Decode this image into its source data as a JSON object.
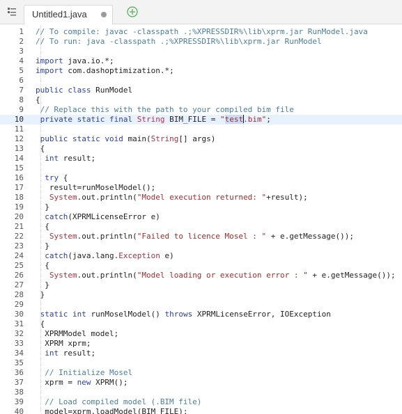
{
  "tab": {
    "title": "Untitled1.java"
  },
  "icons": {
    "menu": "list-menu-icon",
    "unsaved": "unsaved-dot-icon",
    "add": "plus-circle-icon"
  },
  "colors": {
    "comment": "#4a7fa0",
    "keyword": "#2a3fb0",
    "type": "#b03040",
    "string": "#a62a2a",
    "active_line": "#e8f2ff"
  },
  "editor": {
    "active_line": 10,
    "lines": [
      [
        [
          "c",
          "// To compile: javac -classpath .;%XPRESSDIR%\\lib\\xprm.jar RunModel.java"
        ]
      ],
      [
        [
          "c",
          "// To run: java -classpath .;%XPRESSDIR%\\lib\\xprm.jar RunModel"
        ]
      ],
      [],
      [
        [
          "k",
          "import"
        ],
        [
          "n",
          " java.io.*;"
        ]
      ],
      [
        [
          "k",
          "import"
        ],
        [
          "n",
          " com.dashoptimization.*;"
        ]
      ],
      [],
      [
        [
          "k",
          "public"
        ],
        [
          "n",
          " "
        ],
        [
          "k",
          "class"
        ],
        [
          "n",
          " RunModel"
        ]
      ],
      [
        [
          "n",
          "{"
        ]
      ],
      [
        [
          "n",
          " "
        ],
        [
          "c",
          "// Replace this with the path to your compiled bim file"
        ]
      ],
      [
        [
          "n",
          " "
        ],
        [
          "k",
          "private"
        ],
        [
          "n",
          " "
        ],
        [
          "k",
          "static"
        ],
        [
          "n",
          " "
        ],
        [
          "k",
          "final"
        ],
        [
          "n",
          " "
        ],
        [
          "t",
          "String"
        ],
        [
          "n",
          " BIM_FILE = "
        ],
        [
          "s",
          "\""
        ],
        [
          "sel",
          "test"
        ],
        [
          "caret",
          ""
        ],
        [
          "s",
          ".bim\""
        ],
        [
          "n",
          ";"
        ]
      ],
      [],
      [
        [
          "n",
          " "
        ],
        [
          "k",
          "public"
        ],
        [
          "n",
          " "
        ],
        [
          "k",
          "static"
        ],
        [
          "n",
          " "
        ],
        [
          "k",
          "void"
        ],
        [
          "n",
          " main("
        ],
        [
          "t",
          "String"
        ],
        [
          "n",
          "[] args)"
        ]
      ],
      [
        [
          "n",
          " {"
        ]
      ],
      [
        [
          "n",
          "  "
        ],
        [
          "k",
          "int"
        ],
        [
          "n",
          " result;"
        ]
      ],
      [],
      [
        [
          "n",
          "  "
        ],
        [
          "k",
          "try"
        ],
        [
          "n",
          " {"
        ]
      ],
      [
        [
          "n",
          "   result=runMoselModel();"
        ]
      ],
      [
        [
          "n",
          "   "
        ],
        [
          "t",
          "System"
        ],
        [
          "n",
          ".out.println("
        ],
        [
          "s",
          "\"Model execution returned: \""
        ],
        [
          "n",
          "+result);"
        ]
      ],
      [
        [
          "n",
          "  }"
        ]
      ],
      [
        [
          "n",
          "  "
        ],
        [
          "k",
          "catch"
        ],
        [
          "n",
          "(XPRMLicenseError e)"
        ]
      ],
      [
        [
          "n",
          "  {"
        ]
      ],
      [
        [
          "n",
          "   "
        ],
        [
          "t",
          "System"
        ],
        [
          "n",
          ".out.println("
        ],
        [
          "s",
          "\"Failed to licence Mosel : \""
        ],
        [
          "n",
          " + e.getMessage());"
        ]
      ],
      [
        [
          "n",
          "  }"
        ]
      ],
      [
        [
          "n",
          "  "
        ],
        [
          "k",
          "catch"
        ],
        [
          "n",
          "(java.lang."
        ],
        [
          "t",
          "Exception"
        ],
        [
          "n",
          " e)"
        ]
      ],
      [
        [
          "n",
          "  {"
        ]
      ],
      [
        [
          "n",
          "   "
        ],
        [
          "t",
          "System"
        ],
        [
          "n",
          ".out.println("
        ],
        [
          "s",
          "\"Model loading or execution error : \""
        ],
        [
          "n",
          " + e.getMessage());"
        ]
      ],
      [
        [
          "n",
          "  }"
        ]
      ],
      [
        [
          "n",
          " }"
        ]
      ],
      [],
      [
        [
          "n",
          " "
        ],
        [
          "k",
          "static"
        ],
        [
          "n",
          " "
        ],
        [
          "k",
          "int"
        ],
        [
          "n",
          " runMoselModel() "
        ],
        [
          "k",
          "throws"
        ],
        [
          "n",
          " XPRMLicenseError, IOException"
        ]
      ],
      [
        [
          "n",
          " {"
        ]
      ],
      [
        [
          "n",
          "  XPRMModel model;"
        ]
      ],
      [
        [
          "n",
          "  XPRM xprm;"
        ]
      ],
      [
        [
          "n",
          "  "
        ],
        [
          "k",
          "int"
        ],
        [
          "n",
          " result;"
        ]
      ],
      [],
      [
        [
          "n",
          "  "
        ],
        [
          "c",
          "// Initialize Mosel"
        ]
      ],
      [
        [
          "n",
          "  xprm = "
        ],
        [
          "k",
          "new"
        ],
        [
          "n",
          " XPRM();"
        ]
      ],
      [],
      [
        [
          "n",
          "  "
        ],
        [
          "c",
          "// Load compiled model (.BIM file)"
        ]
      ],
      [
        [
          "n",
          "  model=xprm.loadModel(BIM_FILE);"
        ]
      ]
    ]
  }
}
